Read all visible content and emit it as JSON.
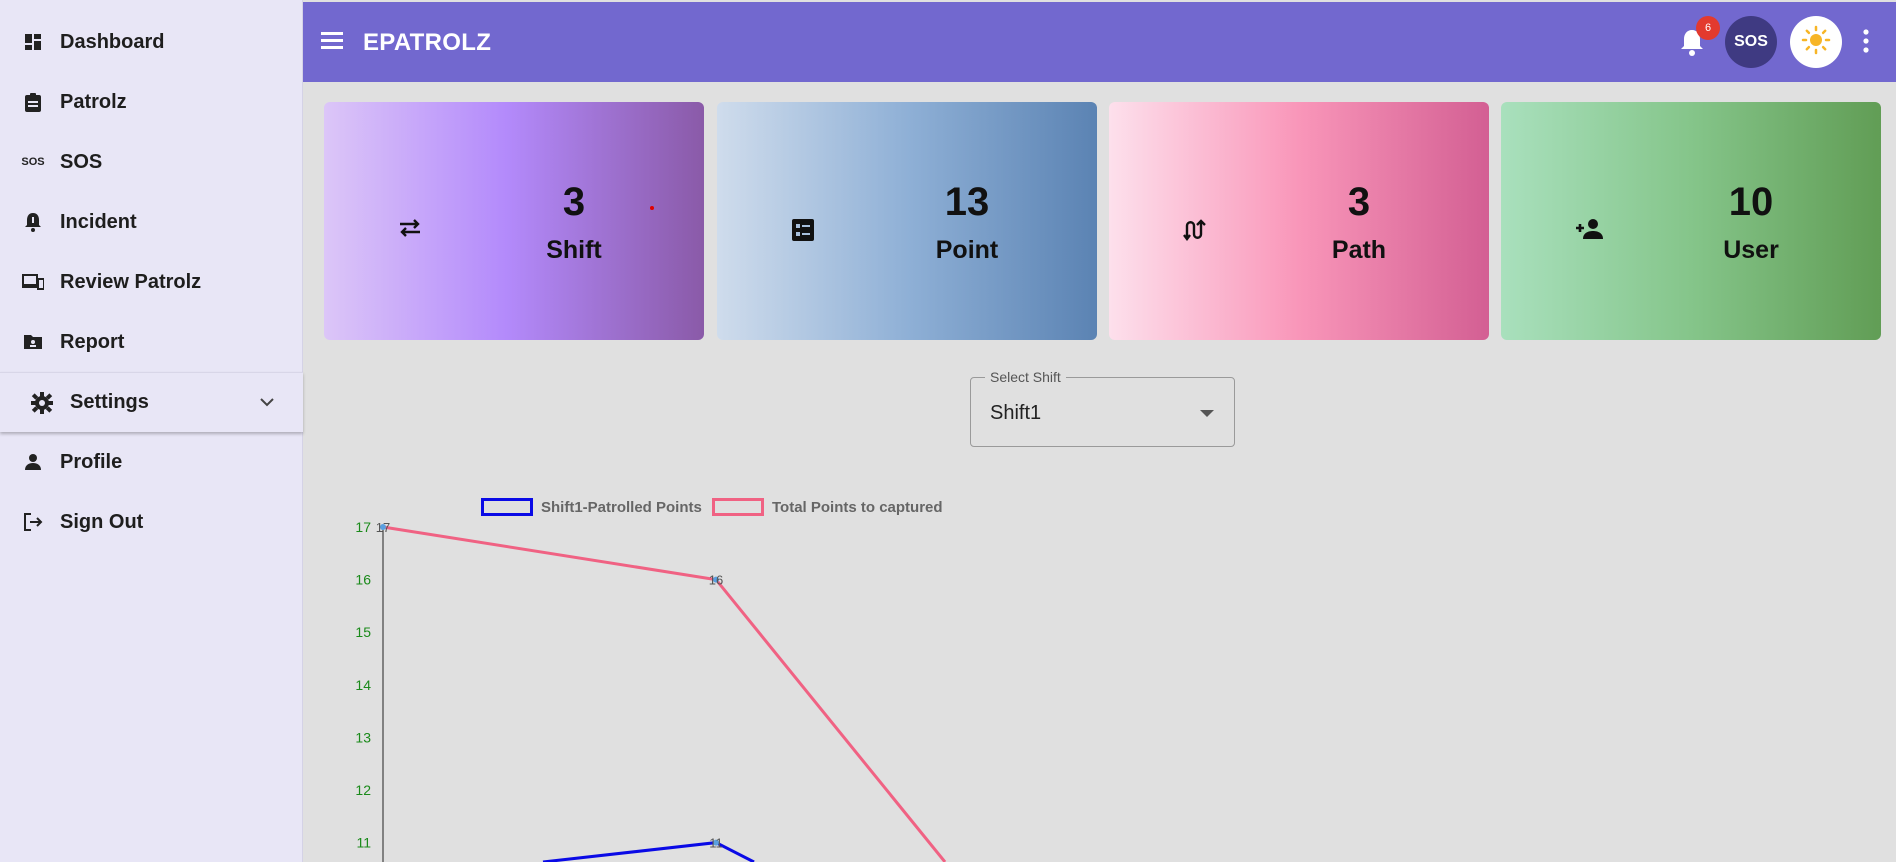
{
  "sidebar": {
    "items": [
      {
        "label": "Dashboard",
        "icon": "dashboard-icon"
      },
      {
        "label": "Patrolz",
        "icon": "clipboard-icon"
      },
      {
        "label": "SOS",
        "icon": "sos-icon"
      },
      {
        "label": "Incident",
        "icon": "alarm-bell-icon"
      },
      {
        "label": "Review Patrolz",
        "icon": "devices-icon"
      },
      {
        "label": "Report",
        "icon": "report-folder-icon"
      },
      {
        "label": "Settings",
        "icon": "gear-icon"
      },
      {
        "label": "Profile",
        "icon": "person-icon"
      },
      {
        "label": "Sign Out",
        "icon": "logout-icon"
      }
    ]
  },
  "header": {
    "title": "EPATROLZ",
    "notification_count": "6",
    "sos_label": "SOS",
    "color": "#7268cf"
  },
  "cards": [
    {
      "value": "3",
      "label": "Shift",
      "icon": "swap-arrows-icon"
    },
    {
      "value": "13",
      "label": "Point",
      "icon": "checklist-icon"
    },
    {
      "value": "3",
      "label": "Path",
      "icon": "route-icon"
    },
    {
      "value": "10",
      "label": "User",
      "icon": "person-add-icon"
    }
  ],
  "shift_select": {
    "label": "Select Shift",
    "value": "Shift1"
  },
  "chart_data": {
    "type": "line",
    "x": [
      "",
      "",
      ""
    ],
    "series": [
      {
        "name": "Shift1-Patrolled Points",
        "values": [
          null,
          11,
          null
        ],
        "color": "#0a0ae6"
      },
      {
        "name": "Total Points to captured",
        "values": [
          17,
          16,
          null
        ],
        "color": "#f06283"
      }
    ],
    "point_labels": [
      "17",
      "16",
      "11"
    ],
    "y_ticks": [
      17,
      16,
      15,
      14,
      13,
      12,
      11
    ],
    "ylim": [
      10.6,
      17
    ]
  }
}
